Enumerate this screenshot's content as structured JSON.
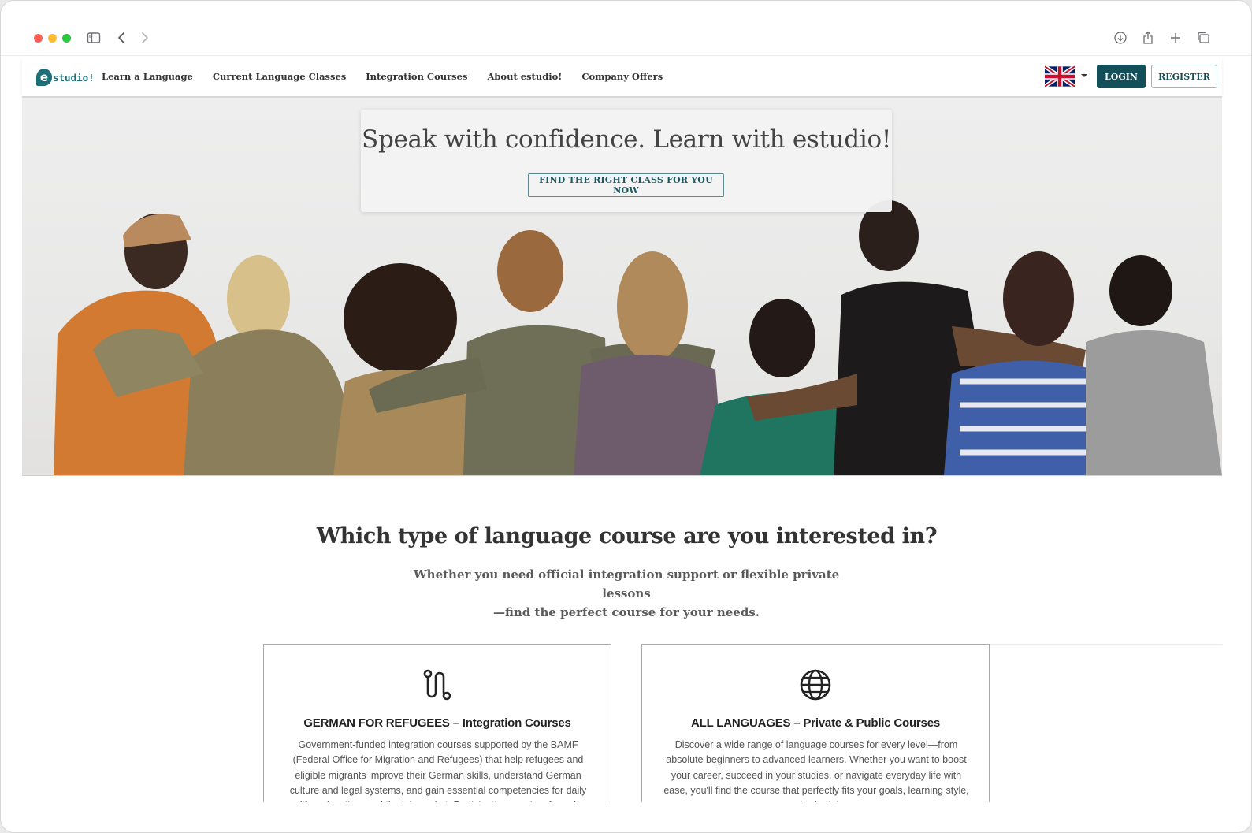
{
  "browser": {
    "icons": [
      "sidebar-icon",
      "back-icon",
      "forward-icon",
      "download-icon",
      "share-icon",
      "new-tab-icon",
      "tabs-overview-icon"
    ]
  },
  "nav": {
    "logo_mark": "e",
    "logo_text": "studio!",
    "links": [
      "Learn a Language",
      "Current Language Classes",
      "Integration Courses",
      "About estudio!",
      "Company Offers"
    ],
    "language_flag": "uk-flag-icon",
    "login_label": "LOGIN",
    "register_label": "REGISTER"
  },
  "hero": {
    "headline": "Speak with confidence. Learn with estudio!",
    "cta_label": "FIND THE RIGHT CLASS FOR YOU NOW"
  },
  "section": {
    "title": "Which type of language course are you interested in?",
    "subtitle_line1": "Whether you need official integration support or flexible private lessons",
    "subtitle_line2": "—find the perfect course for your needs."
  },
  "cards": [
    {
      "icon": "route-icon",
      "title": "GERMAN FOR REFUGEES – Integration Courses",
      "text": "Government-funded integration courses supported by the BAMF (Federal Office for Migration and Refugees) that help refugees and eligible migrants improve their German skills, understand German culture and legal systems, and gain essential competencies for daily life, education, and the job market. Participation requires formal"
    },
    {
      "icon": "globe-icon",
      "title": "ALL LANGUAGES – Private & Public Courses",
      "text": "Discover a wide range of language courses for every level—from absolute beginners to advanced learners. Whether you want to boost your career, succeed in your studies, or navigate everyday life with ease, you'll find the course that perfectly fits your goals, learning style, and schedule."
    }
  ],
  "colors": {
    "brand": "#124f58",
    "logo": "#1c6f78",
    "text_dark": "#333333"
  }
}
